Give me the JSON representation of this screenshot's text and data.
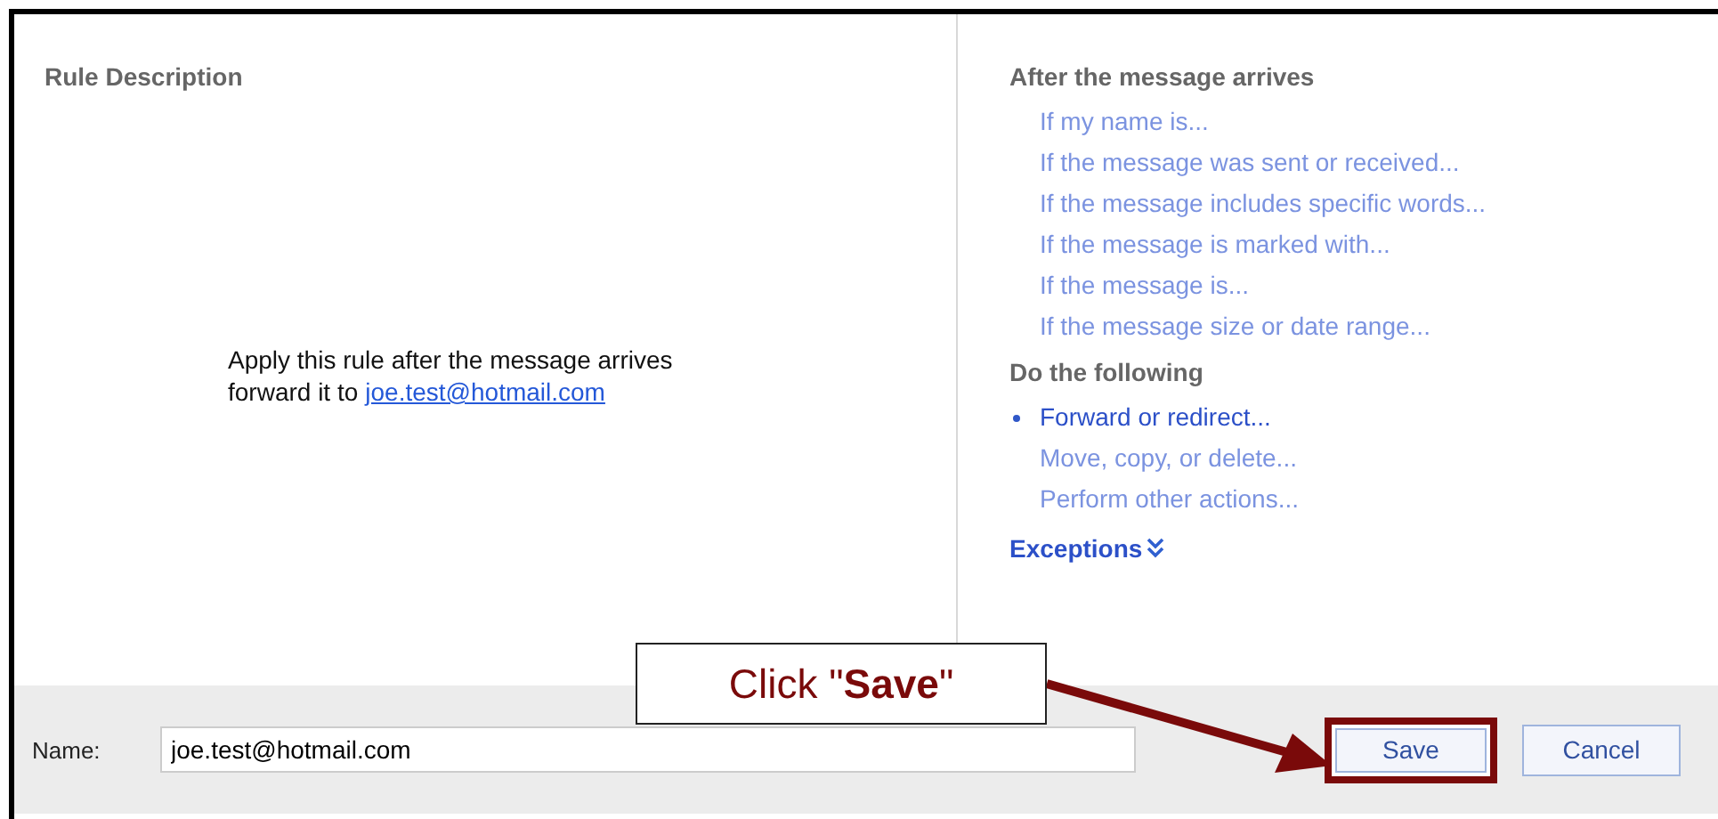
{
  "rule_description": {
    "title": "Rule Description",
    "line_1": "Apply this rule after the message arrives",
    "line_2_prefix": "forward it to",
    "link": "joe.test@hotmail.com"
  },
  "conditions": {
    "title": "After the message arrives",
    "items": [
      {
        "label": "If my name is...",
        "selected": false
      },
      {
        "label": "If the message was sent or received...",
        "selected": false
      },
      {
        "label": "If the message includes specific words...",
        "selected": false
      },
      {
        "label": "If the message is marked with...",
        "selected": false
      },
      {
        "label": "If the message is...",
        "selected": false
      },
      {
        "label": "If the message size or date range...",
        "selected": false
      }
    ]
  },
  "actions": {
    "title": "Do the following",
    "items": [
      {
        "label": "Forward or redirect...",
        "selected": true
      },
      {
        "label": "Move, copy, or delete...",
        "selected": false
      },
      {
        "label": "Perform other actions...",
        "selected": false
      }
    ]
  },
  "exceptions": {
    "label": "Exceptions",
    "expanded": false
  },
  "name_field": {
    "label": "Name:",
    "value": "joe.test@hotmail.com"
  },
  "buttons": [
    {
      "label": "Save",
      "highlighted": true
    },
    {
      "label": "Cancel",
      "highlighted": false
    }
  ],
  "callout": {
    "text": "Click \"**Save**\""
  }
}
